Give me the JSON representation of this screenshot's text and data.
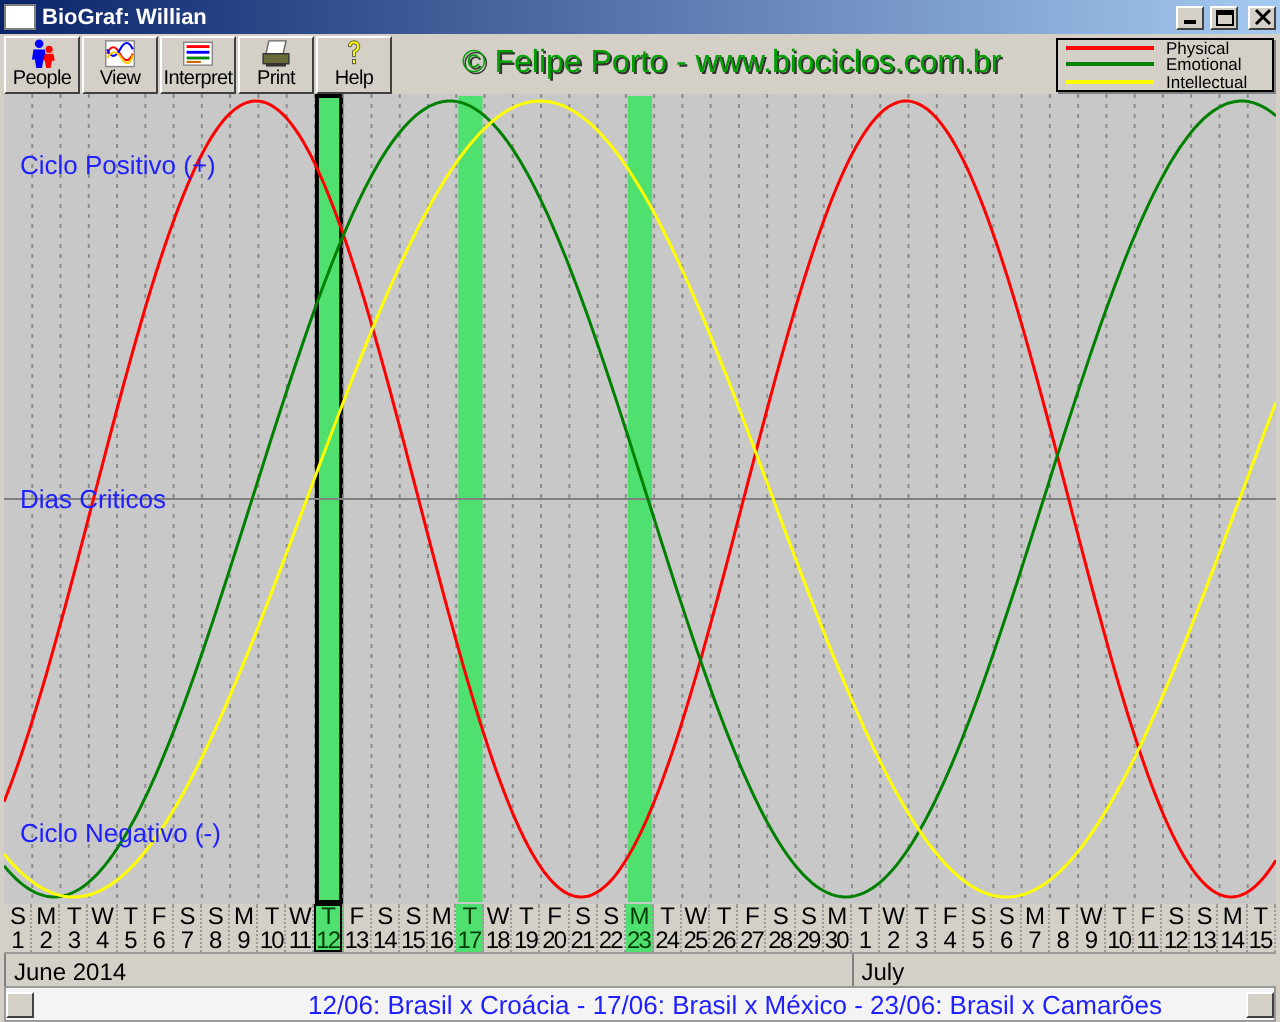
{
  "window": {
    "title": "BioGraf: Willian"
  },
  "toolbar": [
    {
      "label": "People",
      "kind": "people"
    },
    {
      "label": "View",
      "kind": "view"
    },
    {
      "label": "Interpret",
      "kind": "interpret"
    },
    {
      "label": "Print",
      "kind": "print"
    },
    {
      "label": "Help",
      "kind": "help"
    }
  ],
  "banner": "© Felipe Porto - www.biociclos.com.br",
  "legend": [
    {
      "label": "Physical",
      "kind": "physical",
      "color": "#ff0000"
    },
    {
      "label": "Emotional",
      "kind": "emotional",
      "color": "#008000"
    },
    {
      "label": "Intellectual",
      "kind": "intellectual",
      "color": "#ffff00"
    }
  ],
  "axis_labels": [
    "Ciclo Positivo (+)",
    "Dias Criticos",
    "Ciclo Negativo (-)"
  ],
  "days": [
    {
      "weekday": "S",
      "day": "1",
      "highlighted": false,
      "selected": false
    },
    {
      "weekday": "M",
      "day": "2",
      "highlighted": false,
      "selected": false
    },
    {
      "weekday": "T",
      "day": "3",
      "highlighted": false,
      "selected": false
    },
    {
      "weekday": "W",
      "day": "4",
      "highlighted": false,
      "selected": false
    },
    {
      "weekday": "T",
      "day": "5",
      "highlighted": false,
      "selected": false
    },
    {
      "weekday": "F",
      "day": "6",
      "highlighted": false,
      "selected": false
    },
    {
      "weekday": "S",
      "day": "7",
      "highlighted": false,
      "selected": false
    },
    {
      "weekday": "S",
      "day": "8",
      "highlighted": false,
      "selected": false
    },
    {
      "weekday": "M",
      "day": "9",
      "highlighted": false,
      "selected": false
    },
    {
      "weekday": "T",
      "day": "10",
      "highlighted": false,
      "selected": false
    },
    {
      "weekday": "W",
      "day": "11",
      "highlighted": false,
      "selected": false
    },
    {
      "weekday": "T",
      "day": "12",
      "highlighted": true,
      "selected": true
    },
    {
      "weekday": "F",
      "day": "13",
      "highlighted": false,
      "selected": false
    },
    {
      "weekday": "S",
      "day": "14",
      "highlighted": false,
      "selected": false
    },
    {
      "weekday": "S",
      "day": "15",
      "highlighted": false,
      "selected": false
    },
    {
      "weekday": "M",
      "day": "16",
      "highlighted": false,
      "selected": false
    },
    {
      "weekday": "T",
      "day": "17",
      "highlighted": true,
      "selected": false
    },
    {
      "weekday": "W",
      "day": "18",
      "highlighted": false,
      "selected": false
    },
    {
      "weekday": "T",
      "day": "19",
      "highlighted": false,
      "selected": false
    },
    {
      "weekday": "F",
      "day": "20",
      "highlighted": false,
      "selected": false
    },
    {
      "weekday": "S",
      "day": "21",
      "highlighted": false,
      "selected": false
    },
    {
      "weekday": "S",
      "day": "22",
      "highlighted": false,
      "selected": false
    },
    {
      "weekday": "M",
      "day": "23",
      "highlighted": true,
      "selected": false
    },
    {
      "weekday": "T",
      "day": "24",
      "highlighted": false,
      "selected": false
    },
    {
      "weekday": "W",
      "day": "25",
      "highlighted": false,
      "selected": false
    },
    {
      "weekday": "T",
      "day": "26",
      "highlighted": false,
      "selected": false
    },
    {
      "weekday": "F",
      "day": "27",
      "highlighted": false,
      "selected": false
    },
    {
      "weekday": "S",
      "day": "28",
      "highlighted": false,
      "selected": false
    },
    {
      "weekday": "S",
      "day": "29",
      "highlighted": false,
      "selected": false
    },
    {
      "weekday": "M",
      "day": "30",
      "highlighted": false,
      "selected": false
    },
    {
      "weekday": "T",
      "day": "1",
      "highlighted": false,
      "selected": false
    },
    {
      "weekday": "W",
      "day": "2",
      "highlighted": false,
      "selected": false
    },
    {
      "weekday": "T",
      "day": "3",
      "highlighted": false,
      "selected": false
    },
    {
      "weekday": "F",
      "day": "4",
      "highlighted": false,
      "selected": false
    },
    {
      "weekday": "S",
      "day": "5",
      "highlighted": false,
      "selected": false
    },
    {
      "weekday": "S",
      "day": "6",
      "highlighted": false,
      "selected": false
    },
    {
      "weekday": "M",
      "day": "7",
      "highlighted": false,
      "selected": false
    },
    {
      "weekday": "T",
      "day": "8",
      "highlighted": false,
      "selected": false
    },
    {
      "weekday": "W",
      "day": "9",
      "highlighted": false,
      "selected": false
    },
    {
      "weekday": "T",
      "day": "10",
      "highlighted": false,
      "selected": false
    },
    {
      "weekday": "F",
      "day": "11",
      "highlighted": false,
      "selected": false
    },
    {
      "weekday": "S",
      "day": "12",
      "highlighted": false,
      "selected": false
    },
    {
      "weekday": "S",
      "day": "13",
      "highlighted": false,
      "selected": false
    },
    {
      "weekday": "M",
      "day": "14",
      "highlighted": false,
      "selected": false
    },
    {
      "weekday": "T",
      "day": "15",
      "highlighted": false,
      "selected": false
    }
  ],
  "months": [
    {
      "label": "June 2014"
    },
    {
      "label": "July"
    }
  ],
  "ticker": "12/06: Brasil x Croácia - 17/06: Brasil x México - 23/06: Brasil x Camarões"
}
